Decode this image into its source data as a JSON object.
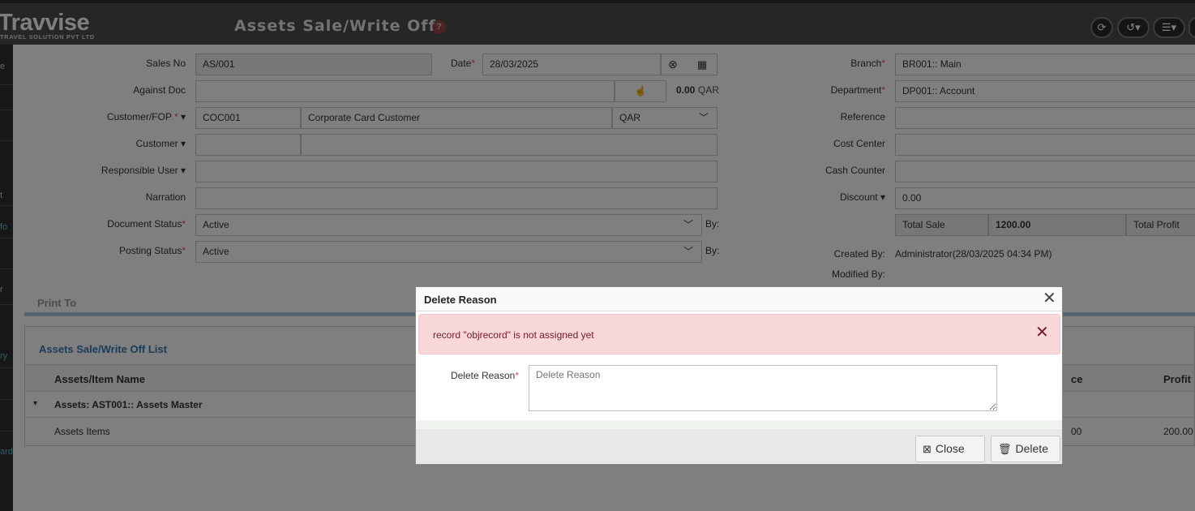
{
  "app": {
    "logo_main": "Travvise",
    "logo_sub": "TRAVEL SOLUTION PVT LTD",
    "page_title": "Assets Sale/Write Off",
    "help_icon": "?"
  },
  "header_buttons": [
    {
      "icon": "refresh-icon",
      "glyph": "⟳"
    },
    {
      "icon": "history-icon",
      "glyph": "↺▾"
    },
    {
      "icon": "menu-icon",
      "glyph": "☰▾"
    }
  ],
  "leftnav_ticks": [
    "e",
    "t",
    "fo",
    "r",
    "ry",
    "ard"
  ],
  "form": {
    "sales_no_label": "Sales No",
    "sales_no_value": "AS/001",
    "date_label": "Date",
    "date_value": "28/03/2025",
    "branch_label": "Branch",
    "branch_value": "BR001:: Main",
    "against_doc_label": "Against Doc",
    "against_amount": "0.00",
    "against_currency": "QAR",
    "department_label": "Department",
    "department_value": "DP001:: Account",
    "customer_fop_label": "Customer/FOP",
    "customer_code": "COC001",
    "customer_name": "Corporate Card Customer",
    "currency_value": "QAR",
    "reference_label": "Reference",
    "customer_label": "Customer",
    "cost_center_label": "Cost Center",
    "responsible_user_label": "Responsible User",
    "cash_counter_label": "Cash Counter",
    "narration_label": "Narration",
    "discount_label": "Discount",
    "discount_value": "0.00",
    "document_status_label": "Document Status",
    "document_status_value": "Active",
    "by_label": "By:",
    "total_sale_label": "Total Sale",
    "total_sale_value": "1200.00",
    "total_profit_label": "Total Profit",
    "posting_status_label": "Posting Status",
    "posting_status_value": "Active",
    "created_by_label": "Created By:",
    "created_by_value": "Administrator(28/03/2025 04:34 PM)",
    "modified_by_label": "Modified By:"
  },
  "print_to_label": "Print To",
  "list": {
    "title": "Assets Sale/Write Off List",
    "col_item": "Assets/Item Name",
    "col_price": "ce",
    "col_profit": "Profit",
    "group_row": "Assets: AST001:: Assets Master",
    "item_row": "Assets Items",
    "item_price_tail": "00",
    "item_profit": "200.00"
  },
  "modal": {
    "title": "Delete Reason",
    "close_glyph": "✕",
    "alert_text": "record \"objrecord\" is not assigned yet",
    "reason_label": "Delete Reason",
    "reason_placeholder": "Delete Reason",
    "reason_value": "",
    "close_button": "Close",
    "delete_button": "Delete"
  }
}
